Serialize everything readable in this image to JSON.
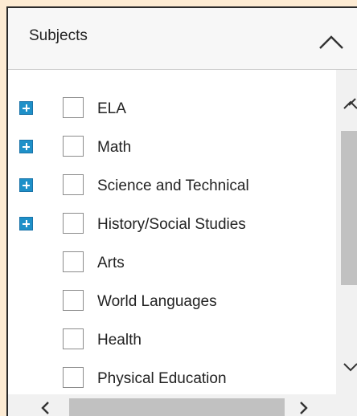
{
  "panel": {
    "title": "Subjects",
    "collapse_icon": "chevron-up-icon"
  },
  "subjects": [
    {
      "label": "ELA",
      "expandable": true,
      "checked": false
    },
    {
      "label": "Math",
      "expandable": true,
      "checked": false
    },
    {
      "label": "Science and Technical",
      "expandable": true,
      "checked": false
    },
    {
      "label": "History/Social Studies",
      "expandable": true,
      "checked": false
    },
    {
      "label": "Arts",
      "expandable": false,
      "checked": false
    },
    {
      "label": "World Languages",
      "expandable": false,
      "checked": false
    },
    {
      "label": "Health",
      "expandable": false,
      "checked": false
    },
    {
      "label": "Physical Education",
      "expandable": false,
      "checked": false
    }
  ],
  "icons": {
    "expand": "plus-box-icon",
    "scroll_up": "chevron-up-icon",
    "scroll_down": "chevron-down-icon",
    "scroll_left": "chevron-left-icon",
    "scroll_right": "chevron-right-icon"
  },
  "colors": {
    "page_background": "#fdebd3",
    "expand_icon": "#1e90c8",
    "header_background": "#f7f7f7",
    "scrollbar_track": "#f1f1f1",
    "scrollbar_thumb": "#c1c1c1"
  }
}
